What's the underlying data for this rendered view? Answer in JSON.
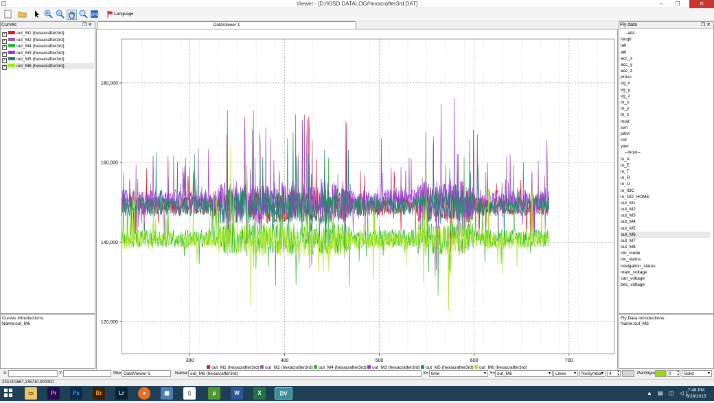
{
  "window": {
    "title": "Viewer - [D:/IOSD DATALOG/hexacrafter3rd.DAT]"
  },
  "toolbar": {
    "language_label": "Languag",
    "icons": [
      "new-icon",
      "open-icon",
      "pointer-icon",
      "zoom-in-icon",
      "zoom-out-icon",
      "hand-icon",
      "zoom-fit-icon",
      "gps-icon",
      "flag-icon"
    ]
  },
  "curves_panel": {
    "title": "Curves",
    "items": [
      {
        "label": "out_M1 (hexacrafter3rd)",
        "color": "#e8151b"
      },
      {
        "label": "out_M2 (hexacrafter3rd)",
        "color": "#9b59b6"
      },
      {
        "label": "out_M4 (hexacrafter3rd)",
        "color": "#2eb82e"
      },
      {
        "label": "out_M3 (hexacrafter3rd)",
        "color": "#9e34d6"
      },
      {
        "label": "out_M5 (hexacrafter3rd)",
        "color": "#1a8f6a"
      },
      {
        "label": "out_M6 (hexacrafter3rd)",
        "color": "#a4e81a"
      }
    ],
    "intro_title": "Curves Introductions:",
    "intro_name": "Name:out_M6"
  },
  "tab": {
    "label": "DataViewer 1"
  },
  "fly_panel": {
    "title": "Fly data",
    "items": [
      "--atti--",
      "longti",
      "lati",
      "alti",
      "acc_x",
      "acc_y",
      "acc_z",
      "press",
      "vg_x",
      "vg_y",
      "vg_z",
      "m_x",
      "m_y",
      "m_z",
      "mod",
      "svn",
      "pitch",
      "roll",
      "yaw",
      "--inout--",
      "in_A",
      "in_E",
      "in_T",
      "in_R",
      "in_U",
      "in_IOC",
      "in_GO_HOME",
      "out_M1",
      "out_M2",
      "out_M3",
      "out_M4",
      "out_M5",
      "out_M6",
      "out_M7",
      "out_M8",
      "ctrl_mode",
      "ioc_status",
      "navigation_status",
      "main_voltage",
      "can_voltage",
      "bec_voltage"
    ],
    "selected": "out_M6",
    "intro_title": "Fly Data Introductions:",
    "intro_name": "Name:out_M6"
  },
  "chart_data": {
    "type": "line",
    "title": "",
    "xlabel": "",
    "ylabel": "",
    "xlim": [
      228,
      748
    ],
    "ylim": [
      112000,
      191000
    ],
    "xticks": [
      300,
      400,
      500,
      600,
      700
    ],
    "xtick_labels": [
      "300",
      "400",
      "500",
      "600",
      "700"
    ],
    "yticks": [
      120000,
      140000,
      160000,
      180000
    ],
    "ytick_labels": [
      "120,000",
      "140,000",
      "160,000",
      "180,000"
    ],
    "grid": true,
    "x_end": 679,
    "series": [
      {
        "name": "out_M1 (hexacrafter3rd)",
        "color": "#e8151b",
        "base": 149000,
        "amp": 9000
      },
      {
        "name": "out_M2 (hexacrafter3rd)",
        "color": "#9b59b6",
        "base": 149500,
        "amp": 11000
      },
      {
        "name": "out_M4 (hexacrafter3rd)",
        "color": "#2eb82e",
        "base": 141000,
        "amp": 9000
      },
      {
        "name": "out_M3 (hexacrafter3rd)",
        "color": "#9e34d6",
        "base": 150500,
        "amp": 11000
      },
      {
        "name": "out_M5 (hexacrafter3rd)",
        "color": "#1a8f6a",
        "base": 149000,
        "amp": 10000
      },
      {
        "name": "out_M6 (hexacrafter3rd)",
        "color": "#a4e81a",
        "base": 140500,
        "amp": 9000
      }
    ],
    "legend_position": "bottom"
  },
  "bottom_bar": {
    "x_label": "X:",
    "x_value": "",
    "y_label": "Y:",
    "y_value": "",
    "title_label": "Title:",
    "title_value": "DataViewer 1",
    "name_label": "Name:",
    "name_value": "out_M6 (hexacrafter3rd)",
    "xsel_label": "X=",
    "xsel_value": "time",
    "ysel_label": "Y=",
    "ysel_value": "out_M6",
    "style_value": "Lines",
    "symbol_value": "NoSymbol",
    "width_value": "4",
    "penstyle_label": "PenStyle:",
    "pen_color": "#99dd00",
    "pen_value": "0",
    "line_value": "Solid"
  },
  "status": {
    "coords": "333.001667,135710.000000"
  },
  "taskbar": {
    "time": "7:46 PM",
    "date": "6/28/2015"
  }
}
